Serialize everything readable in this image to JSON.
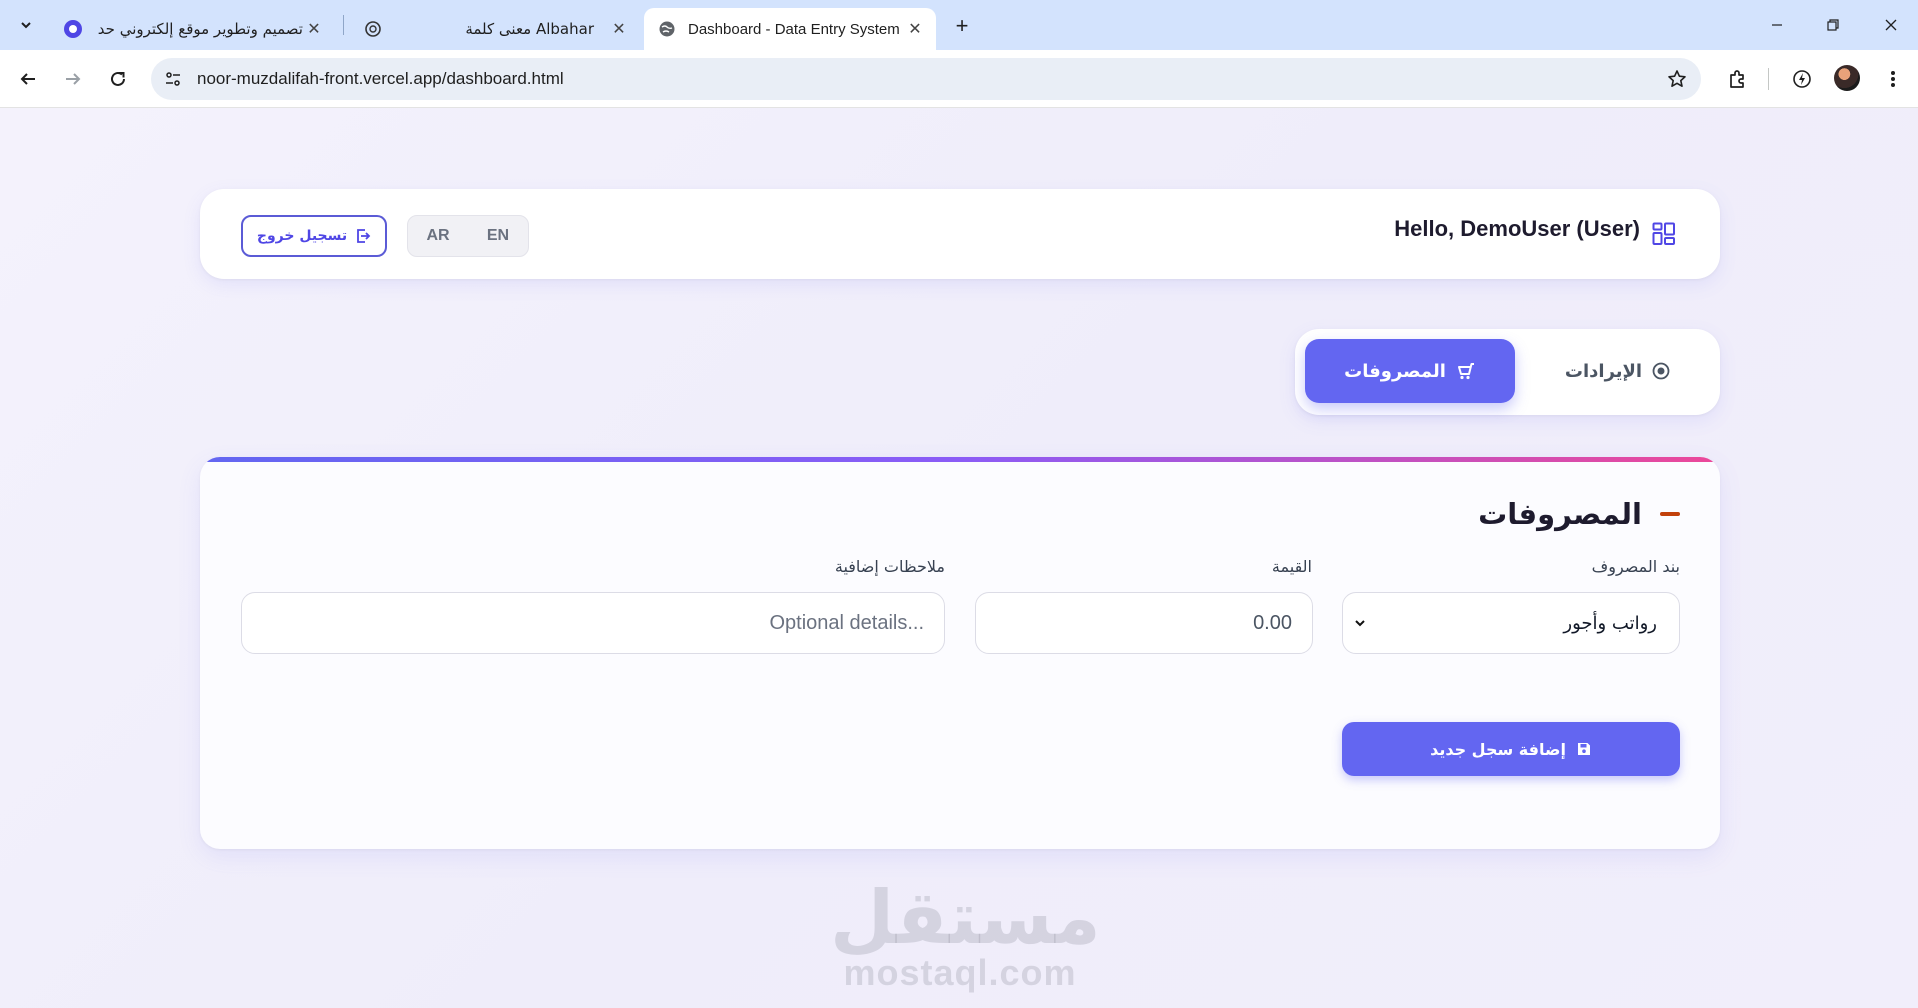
{
  "browser": {
    "tabs": [
      {
        "title": "تصميم وتطوير موقع إلكتروني حد",
        "favicon": "mostaql-icon",
        "active": false
      },
      {
        "title": "معنى كلمة Albahar",
        "favicon": "chatgpt-icon",
        "active": false
      },
      {
        "title": "Dashboard - Data Entry System",
        "favicon": "globe-icon",
        "active": true
      }
    ],
    "url": "noor-muzdalifah-front.vercel.app/dashboard.html"
  },
  "header": {
    "greeting": "Hello, DemoUser (User)",
    "lang_en": "EN",
    "lang_ar": "AR",
    "logout_label": "تسجيل خروج"
  },
  "tabs": {
    "expenses_label": "المصروفات",
    "income_label": "الإيرادات",
    "active": "expenses"
  },
  "form": {
    "title": "المصروفات",
    "item_label": "بند المصروف",
    "item_value": "رواتب وأجور",
    "amount_label": "القيمة",
    "amount_placeholder": "0.00",
    "notes_label": "ملاحظات إضافية",
    "notes_placeholder": "Optional details...",
    "submit_label": "إضافة سجل جديد"
  },
  "watermark": {
    "arabic": "مستقل",
    "latin": "mostaql.com"
  },
  "colors": {
    "accent": "#6366f1",
    "page_bg": "#f1eefb",
    "title_dash": "#c2410c"
  }
}
